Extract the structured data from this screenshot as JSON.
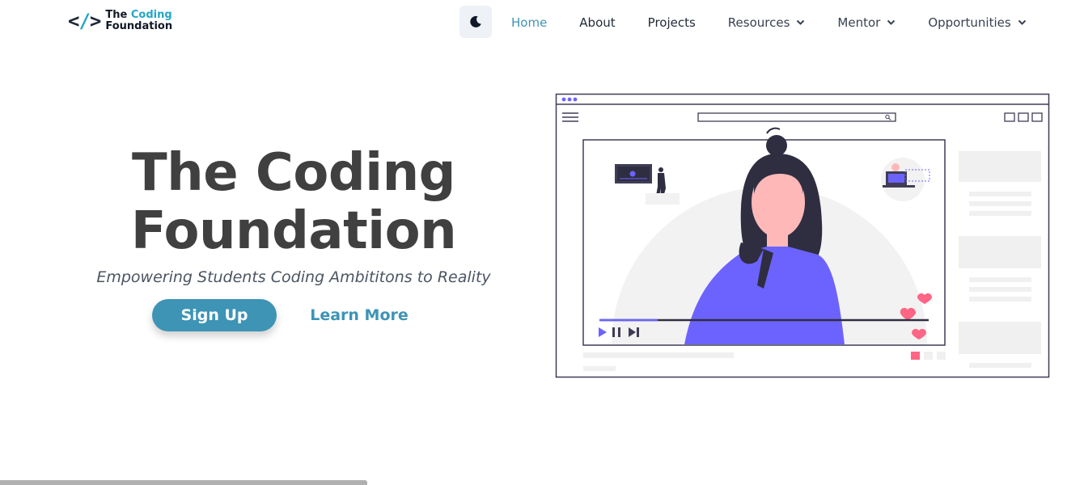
{
  "logo": {
    "mark": "</>",
    "name_line1": "The",
    "name_line1_accent": "Coding",
    "name_line2": "Foundation"
  },
  "theme_toggle": {
    "icon": "moon-icon"
  },
  "nav": {
    "items": [
      {
        "label": "Home",
        "active": true,
        "dropdown": false
      },
      {
        "label": "About",
        "active": false,
        "dropdown": false
      },
      {
        "label": "Projects",
        "active": false,
        "dropdown": false
      },
      {
        "label": "Resources",
        "active": false,
        "dropdown": true
      },
      {
        "label": "Mentor",
        "active": false,
        "dropdown": true
      },
      {
        "label": "Opportunities",
        "active": false,
        "dropdown": true
      }
    ]
  },
  "hero": {
    "title_line1": "The Coding",
    "title_line2": "Foundation",
    "subtitle": "Empowering Students Coding Ambititons to Reality",
    "signup_label": "Sign Up",
    "learn_more_label": "Learn More"
  },
  "colors": {
    "accent": "#3d94b5",
    "logo_accent": "#22a6c7",
    "title": "#404040",
    "illustration_primary": "#6c63ff",
    "heart": "#ff6584"
  }
}
